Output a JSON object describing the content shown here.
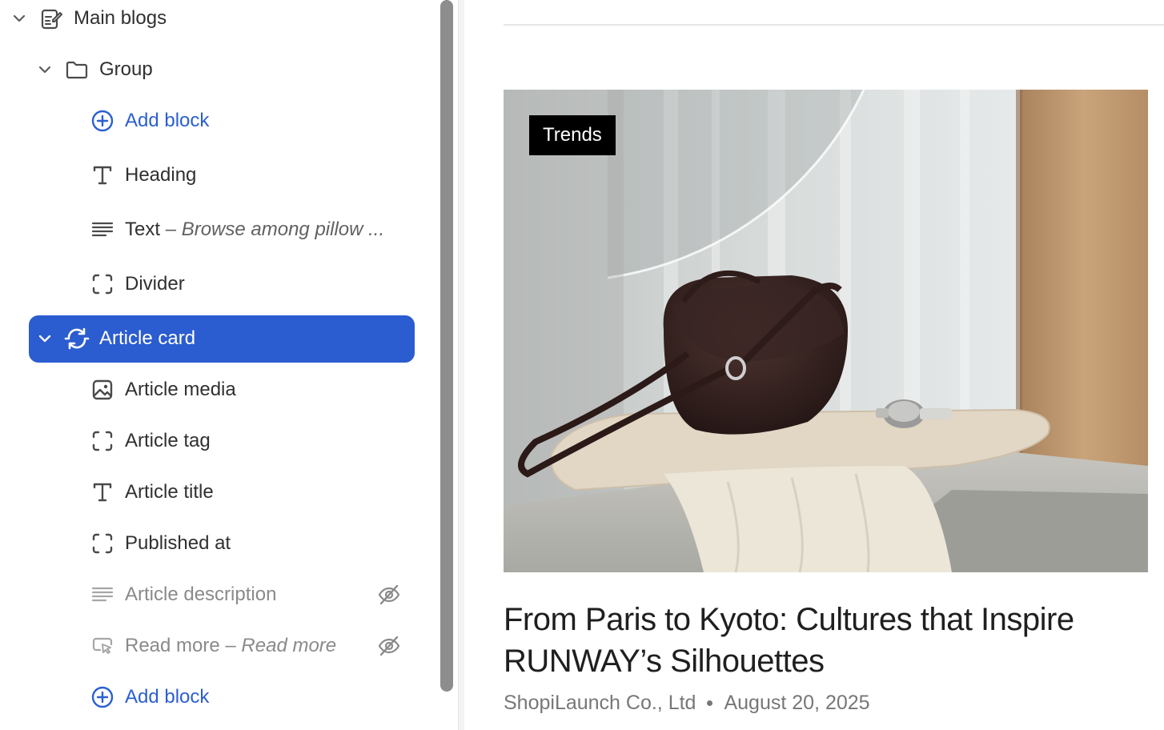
{
  "sidebar": {
    "items": [
      {
        "label": "Main blogs",
        "sub": ""
      },
      {
        "label": "Group",
        "sub": ""
      },
      {
        "label": "Add block",
        "sub": ""
      },
      {
        "label": "Heading",
        "sub": ""
      },
      {
        "label": "Text",
        "sub": "– Browse among pillow ..."
      },
      {
        "label": "Divider",
        "sub": ""
      },
      {
        "label": "Article card",
        "sub": ""
      },
      {
        "label": "Article media",
        "sub": ""
      },
      {
        "label": "Article tag",
        "sub": ""
      },
      {
        "label": "Article title",
        "sub": ""
      },
      {
        "label": "Published at",
        "sub": ""
      },
      {
        "label": "Article description",
        "sub": ""
      },
      {
        "label": "Read more",
        "sub": "– Read more"
      },
      {
        "label": "Add block",
        "sub": ""
      }
    ]
  },
  "preview": {
    "tag": "Trends",
    "title": "From Paris to Kyoto: Cultures that Inspire RUNWAY’s Silhouettes",
    "author": "ShopiLaunch Co., Ltd",
    "date": "August 20, 2025"
  },
  "colors": {
    "accent": "#2b5cd0",
    "text": "#303030",
    "muted": "#8a8a8a"
  }
}
